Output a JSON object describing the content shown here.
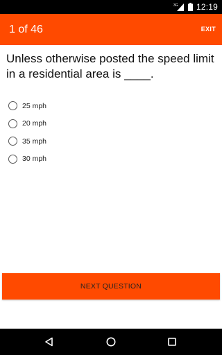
{
  "status_bar": {
    "network": "3G",
    "time": "12:19",
    "icons": [
      "signal-icon",
      "battery-icon"
    ]
  },
  "app_bar": {
    "title": "1 of 46",
    "exit_label": "EXIT",
    "background_color": "#ff4a00"
  },
  "question": {
    "text": "Unless otherwise posted the speed limit in a residential area is ____."
  },
  "options": [
    {
      "label": "25 mph",
      "selected": false
    },
    {
      "label": "20 mph",
      "selected": false
    },
    {
      "label": "35 mph",
      "selected": false
    },
    {
      "label": "30 mph",
      "selected": false
    }
  ],
  "next_button": {
    "label": "NEXT QUESTION"
  },
  "nav_bar": {
    "icons": [
      "back-icon",
      "home-icon",
      "recents-icon"
    ]
  }
}
